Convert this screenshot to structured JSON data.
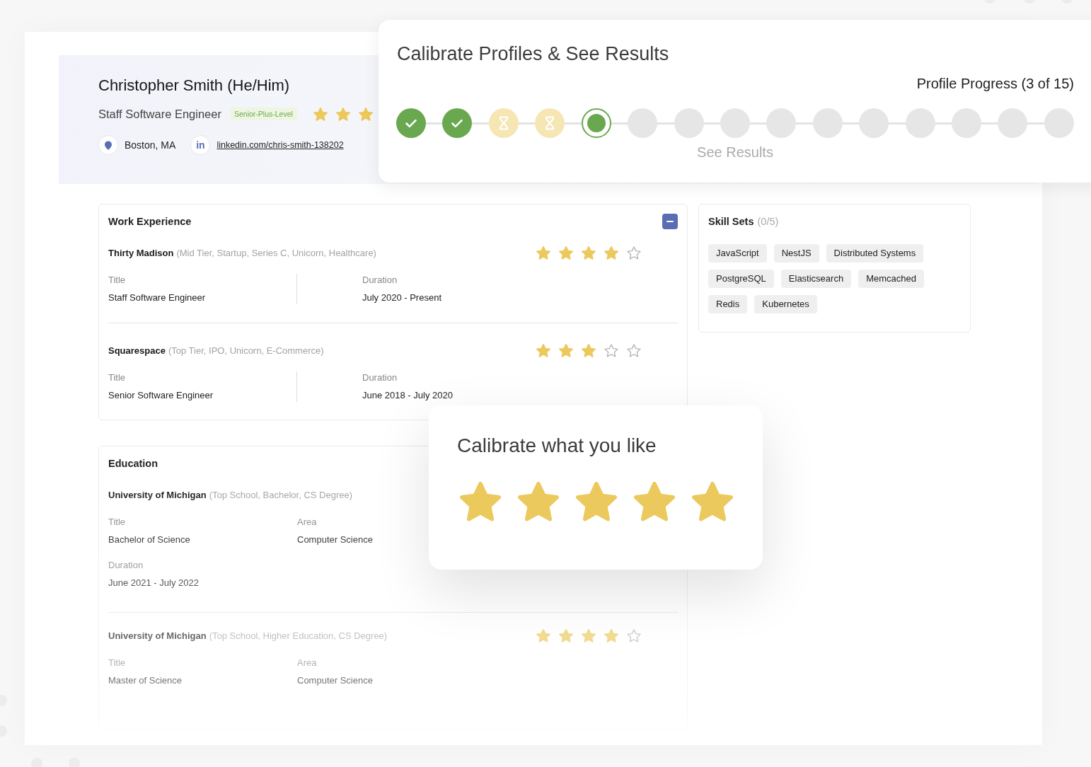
{
  "profile": {
    "name": "Christopher Smith (He/Him)",
    "title": "Staff Software Engineer",
    "level_badge": "Senior-Plus-Level",
    "stars": 3,
    "contacts": [
      {
        "kind": "location",
        "text": "Boston, MA"
      },
      {
        "kind": "link",
        "icon_text": "in",
        "text": "linkedin.com/chris-smith-138202"
      }
    ]
  },
  "work_experience": {
    "title": "Work Experience",
    "expanded": true,
    "entries": [
      {
        "company": "Thirty Madison",
        "tags": "(Mid Tier, Startup, Series C, Unicorn, Healthcare)",
        "stars": 4,
        "fields": [
          {
            "label": "Title",
            "value": "Staff Software Engineer"
          },
          {
            "label": "Duration",
            "value": "July 2020 - Present"
          }
        ]
      },
      {
        "company": "Squarespace",
        "tags": "(Top Tier, IPO, Unicorn, E-Commerce)",
        "stars": 3,
        "fields": [
          {
            "label": "Title",
            "value": "Senior Software Engineer"
          },
          {
            "label": "Duration",
            "value": "June 2018 - July 2020"
          }
        ]
      }
    ]
  },
  "skill_sets": {
    "title": "Skill Sets",
    "count": "(0/5)",
    "skills": [
      "JavaScript",
      "NestJS",
      "Distributed Systems",
      "PostgreSQL",
      "Elasticsearch",
      "Memcached",
      "Redis",
      "Kubernetes"
    ]
  },
  "education": {
    "title": "Education",
    "entries": [
      {
        "school": "University of Michigan",
        "tags": "(Top School, Bachelor, CS Degree)",
        "fields": [
          {
            "label": "Title",
            "value": "Bachelor of Science"
          },
          {
            "label": "Area",
            "value": "Computer Science"
          },
          {
            "label": "Duration",
            "value": "June 2021 - July 2022"
          }
        ]
      },
      {
        "school": "University of Michigan",
        "tags": "(Top School, Higher Education, CS Degree)",
        "stars": 4,
        "fields": [
          {
            "label": "Title",
            "value": "Master of Science"
          },
          {
            "label": "Area",
            "value": "Computer Science"
          }
        ]
      }
    ]
  },
  "progress_card": {
    "title": "Calibrate Profiles & See Results",
    "progress_label": "Profile Progress (3 of 15)",
    "steps": [
      {
        "kind": "done"
      },
      {
        "kind": "done"
      },
      {
        "kind": "pending"
      },
      {
        "kind": "pending"
      },
      {
        "kind": "current"
      },
      {
        "kind": "upcoming"
      },
      {
        "kind": "upcoming"
      },
      {
        "kind": "upcoming"
      },
      {
        "kind": "upcoming"
      },
      {
        "kind": "upcoming"
      },
      {
        "kind": "upcoming"
      },
      {
        "kind": "upcoming"
      },
      {
        "kind": "upcoming"
      },
      {
        "kind": "upcoming"
      },
      {
        "kind": "upcoming"
      }
    ],
    "results_label": "See Results"
  },
  "calibrate_popup": {
    "title": "Calibrate what you like",
    "stars": 5
  }
}
